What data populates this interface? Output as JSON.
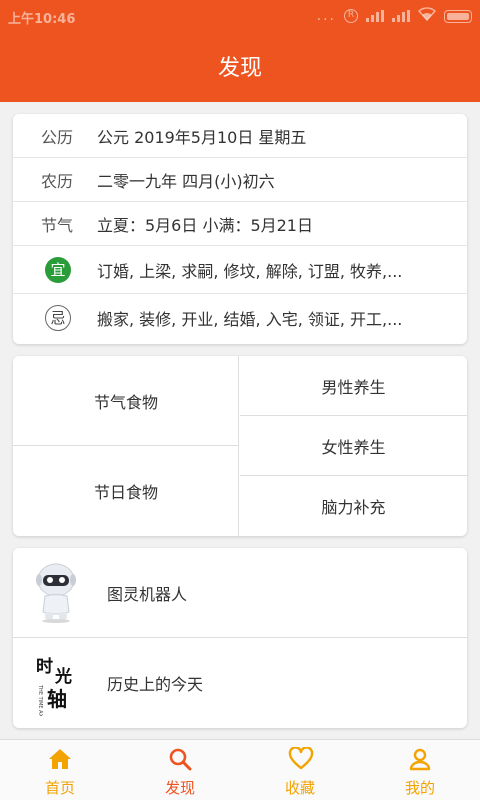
{
  "status_bar": {
    "time": "上午10:46",
    "dots": "...",
    "r_icon": "R"
  },
  "header": {
    "title": "发现"
  },
  "calendar": {
    "rows": [
      {
        "key": "公历",
        "value": "公元 2019年5月10日 星期五"
      },
      {
        "key": "农历",
        "value": "二零一九年 四月(小)初六"
      },
      {
        "key": "节气",
        "value": "立夏：5月6日 小满：5月21日"
      }
    ],
    "yi": {
      "badge": "宜",
      "value": "订婚, 上梁, 求嗣, 修坟, 解除, 订盟, 牧养,..."
    },
    "ji": {
      "badge": "忌",
      "value": "搬家, 装修, 开业, 结婚, 入宅, 领证, 开工,..."
    }
  },
  "food": {
    "left": [
      "节气食物",
      "节日食物"
    ],
    "right": [
      "男性养生",
      "女性养生",
      "脑力补充"
    ]
  },
  "tools": [
    {
      "label": "图灵机器人",
      "icon": "robot-icon"
    },
    {
      "label": "历史上的今天",
      "icon": "time-axis-book-icon",
      "cover_title": "时光轴",
      "cover_sub": "THE TIME AXIS"
    }
  ],
  "nav": {
    "items": [
      {
        "label": "首页",
        "icon": "home-icon"
      },
      {
        "label": "发现",
        "icon": "search-icon",
        "active": true
      },
      {
        "label": "收藏",
        "icon": "heart-icon"
      },
      {
        "label": "我的",
        "icon": "user-icon"
      }
    ]
  },
  "colors": {
    "primary": "#ee5420",
    "nav_inactive": "#f2a300",
    "yi_green": "#2a9d3a"
  }
}
